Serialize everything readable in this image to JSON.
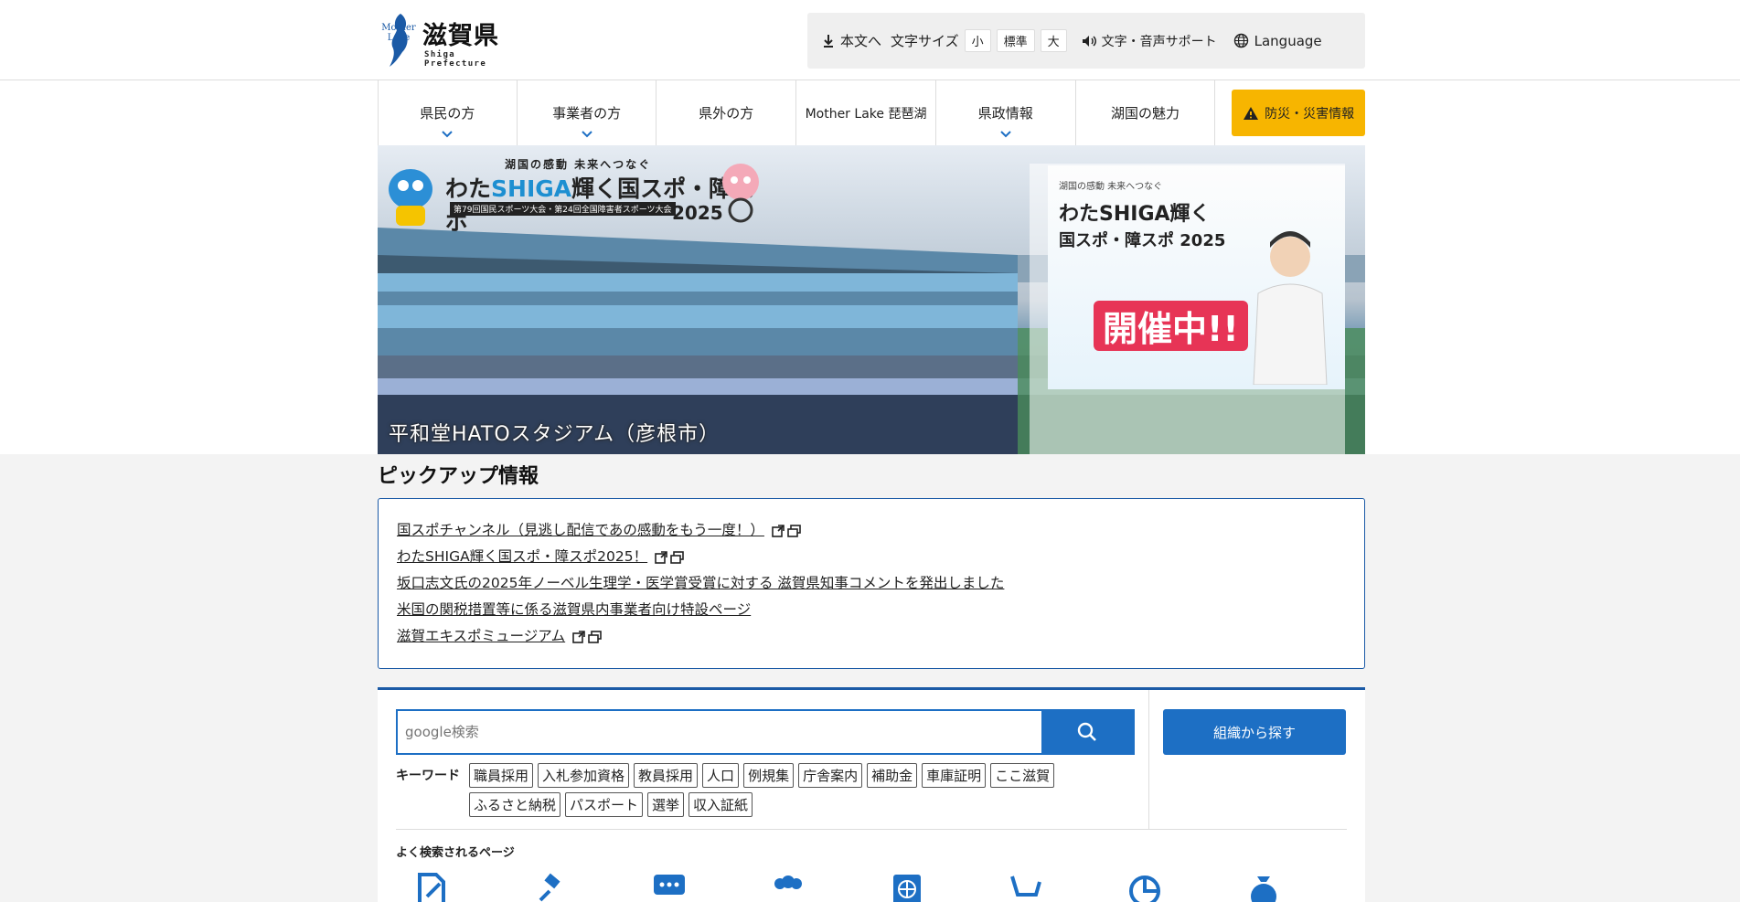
{
  "header": {
    "logo_mother": "Mother",
    "logo_lake": "Lake",
    "logo_name": "滋賀県",
    "logo_sub": "Shiga Prefecture",
    "skip_to_content": "本文へ",
    "font_size_label": "文字サイズ",
    "font_size_small": "小",
    "font_size_normal": "標準",
    "font_size_large": "大",
    "support": "文字・音声サポート",
    "language": "Language"
  },
  "nav": {
    "tabs": [
      {
        "label": "県民の方",
        "has_menu": true
      },
      {
        "label": "事業者の方",
        "has_menu": true
      },
      {
        "label": "県外の方",
        "has_menu": false
      },
      {
        "label": "Mother Lake 琵琶湖",
        "has_menu": false
      },
      {
        "label": "県政情報",
        "has_menu": true
      },
      {
        "label": "湖国の魅力",
        "has_menu": false
      }
    ],
    "bousai": "防災・災害情報"
  },
  "hero": {
    "banner_catch": "湖国の感動 未来へつなぐ",
    "banner_big_prefix": "わた",
    "banner_big_accent": "SHIGA",
    "banner_big_suffix": "輝く国スポ・障スポ",
    "banner_small": "第79回国民スポーツ大会・第24回全国障害者スポーツ大会",
    "banner_year": "2025",
    "poster_catch": "湖国の感動 未来へつなぐ",
    "poster_title_1": "わたSHIGA輝く",
    "poster_title_2": "国スポ・障スポ 2025",
    "poster_badge": "開催中!!",
    "caption": "平和堂HATOスタジアム（彦根市）"
  },
  "pickup": {
    "title": "ピックアップ情報",
    "items": [
      {
        "label": "国スポチャンネル（見逃し配信であの感動をもう一度！）",
        "external": true
      },
      {
        "label": "わたSHIGA輝く国スポ・障スポ2025！",
        "external": true
      },
      {
        "label": "坂口志文氏の2025年ノーベル生理学・医学賞受賞に対する 滋賀県知事コメントを発出しました",
        "external": false
      },
      {
        "label": "米国の関税措置等に係る滋賀県内事業者向け特設ページ",
        "external": false
      },
      {
        "label": "滋賀エキスポミュージアム",
        "external": true
      }
    ]
  },
  "search": {
    "placeholder": "google検索",
    "org_button": "組織から探す",
    "keyword_label": "キーワード",
    "keywords": [
      "職員採用",
      "入札参加資格",
      "教員採用",
      "人口",
      "例規集",
      "庁舎案内",
      "補助金",
      "車庫証明",
      "ここ滋賀",
      "ふるさと納税",
      "パスポート",
      "選挙",
      "収入証紙"
    ],
    "popular_label": "よく検索されるページ"
  },
  "colors": {
    "brand_blue": "#1d6fc4",
    "border_blue": "#1b5aa6",
    "bousai_yellow": "#f7b500"
  }
}
